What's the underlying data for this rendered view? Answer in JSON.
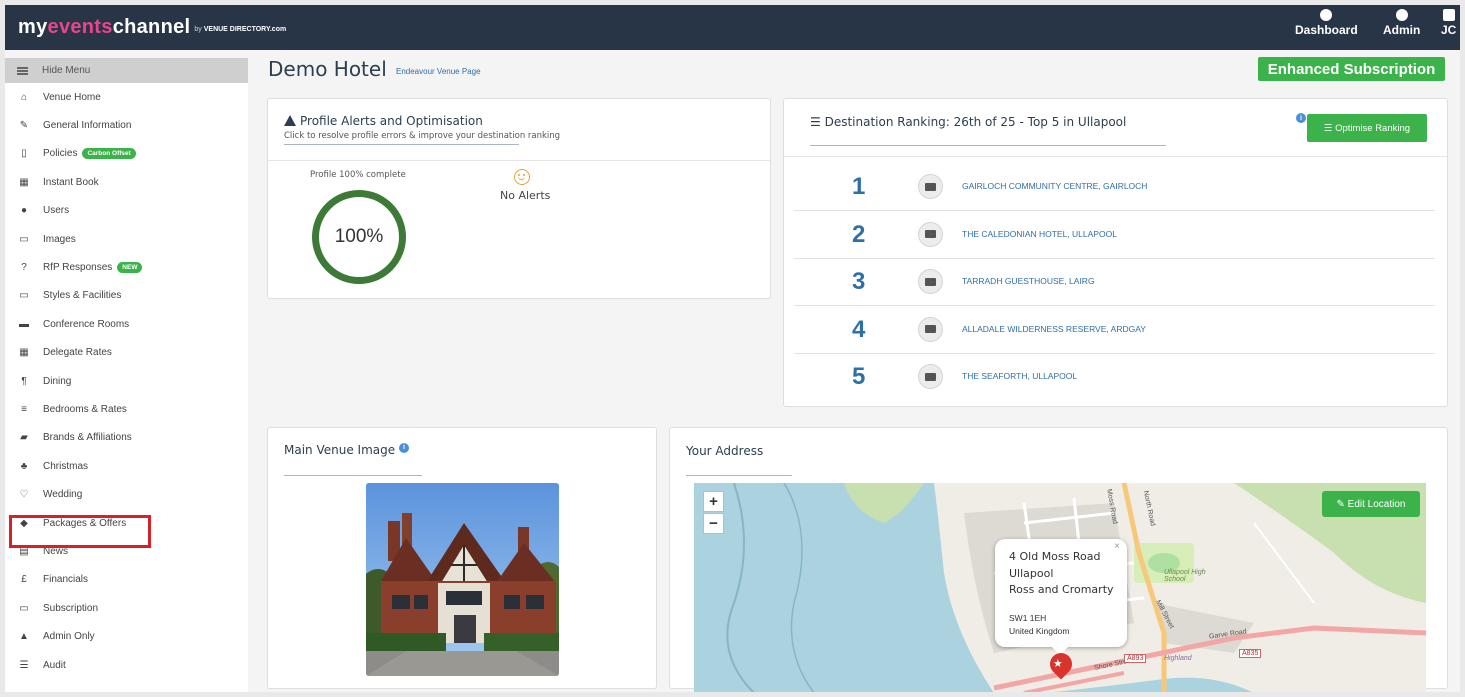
{
  "brand": {
    "my": "my",
    "events": "events",
    "channel": "channel",
    "by": "by",
    "partner": "VENUE DIRECTORY.com"
  },
  "topnav": {
    "dashboard": "Dashboard",
    "admin": "Admin",
    "user_initials": "JC"
  },
  "sidebar": {
    "hide_menu": "Hide Menu",
    "items": [
      {
        "label": "Venue Home",
        "icon": "home-icon",
        "glyph": "⌂"
      },
      {
        "label": "General Information",
        "icon": "edit-icon",
        "glyph": "✎"
      },
      {
        "label": "Policies",
        "icon": "document-icon",
        "glyph": "▯",
        "badge": "Carbon Offset"
      },
      {
        "label": "Instant Book",
        "icon": "calendar-icon",
        "glyph": "▦"
      },
      {
        "label": "Users",
        "icon": "user-icon",
        "glyph": "●"
      },
      {
        "label": "Images",
        "icon": "image-icon",
        "glyph": "▭"
      },
      {
        "label": "RfP Responses",
        "icon": "question-icon",
        "glyph": "?",
        "badge": "NEW"
      },
      {
        "label": "Styles & Facilities",
        "icon": "monitor-icon",
        "glyph": "▭"
      },
      {
        "label": "Conference Rooms",
        "icon": "briefcase-icon",
        "glyph": "▬"
      },
      {
        "label": "Delegate Rates",
        "icon": "calculator-icon",
        "glyph": "▦"
      },
      {
        "label": "Dining",
        "icon": "cutlery-icon",
        "glyph": "¶"
      },
      {
        "label": "Bedrooms & Rates",
        "icon": "bed-icon",
        "glyph": "≡"
      },
      {
        "label": "Brands & Affiliations",
        "icon": "book-icon",
        "glyph": "▰"
      },
      {
        "label": "Christmas",
        "icon": "tree-icon",
        "glyph": "♣"
      },
      {
        "label": "Wedding",
        "icon": "heart-icon",
        "glyph": "♡"
      },
      {
        "label": "Packages & Offers",
        "icon": "tags-icon",
        "glyph": "◆"
      },
      {
        "label": "News",
        "icon": "newspaper-icon",
        "glyph": "▤"
      },
      {
        "label": "Financials",
        "icon": "pound-icon",
        "glyph": "£"
      },
      {
        "label": "Subscription",
        "icon": "credit-card-icon",
        "glyph": "▭"
      },
      {
        "label": "Admin Only",
        "icon": "warning-icon",
        "glyph": "▲"
      },
      {
        "label": "Audit",
        "icon": "list-icon",
        "glyph": "☰"
      }
    ]
  },
  "header": {
    "title": "Demo Hotel",
    "subtitle_link": "Endeavour Venue Page",
    "subscription": "Enhanced Subscription"
  },
  "profile_alerts": {
    "title": "Profile Alerts and Optimisation",
    "subtitle": "Click to resolve profile errors & improve your destination ranking",
    "complete_label": "Profile 100% complete",
    "complete_value": "100%",
    "alerts": "No Alerts"
  },
  "ranking": {
    "title": "Destination Ranking: 26th of 25 - Top 5 in Ullapool",
    "button": "Optimise Ranking",
    "info": "i",
    "rows": [
      {
        "rank": "1",
        "name": "GAIRLOCH COMMUNITY CENTRE, GAIRLOCH"
      },
      {
        "rank": "2",
        "name": "THE CALEDONIAN HOTEL, ULLAPOOL"
      },
      {
        "rank": "3",
        "name": "TARRADH GUESTHOUSE, LAIRG"
      },
      {
        "rank": "4",
        "name": "ALLADALE WILDERNESS RESERVE, ARDGAY"
      },
      {
        "rank": "5",
        "name": "THE SEAFORTH, ULLAPOOL"
      }
    ]
  },
  "venue_image": {
    "title": "Main Venue Image",
    "info": "i"
  },
  "address": {
    "title": "Your Address",
    "edit_button": "Edit Location",
    "zoom_in": "+",
    "zoom_out": "−",
    "close": "×",
    "line1": "4 Old Moss Road",
    "line2": "Ullapool",
    "line3": "Ross and Cromarty",
    "postcode": "SW1 1EH",
    "country": "United Kingdom"
  },
  "map_labels": {
    "north_road": "North Road",
    "mill_street": "Mill Street",
    "shore_street": "Shore Street",
    "garve_road": "Garve Road",
    "moss_road": "Moss Road",
    "high_school": "Ullapool High School",
    "a893": "A893",
    "a835": "A835",
    "highland": "Highland"
  },
  "colors": {
    "topbar": "#273546",
    "accent_pink": "#e8458f",
    "green": "#3cb34a",
    "link_blue": "#2f6fa8",
    "highlight_red": "#d8202a"
  }
}
